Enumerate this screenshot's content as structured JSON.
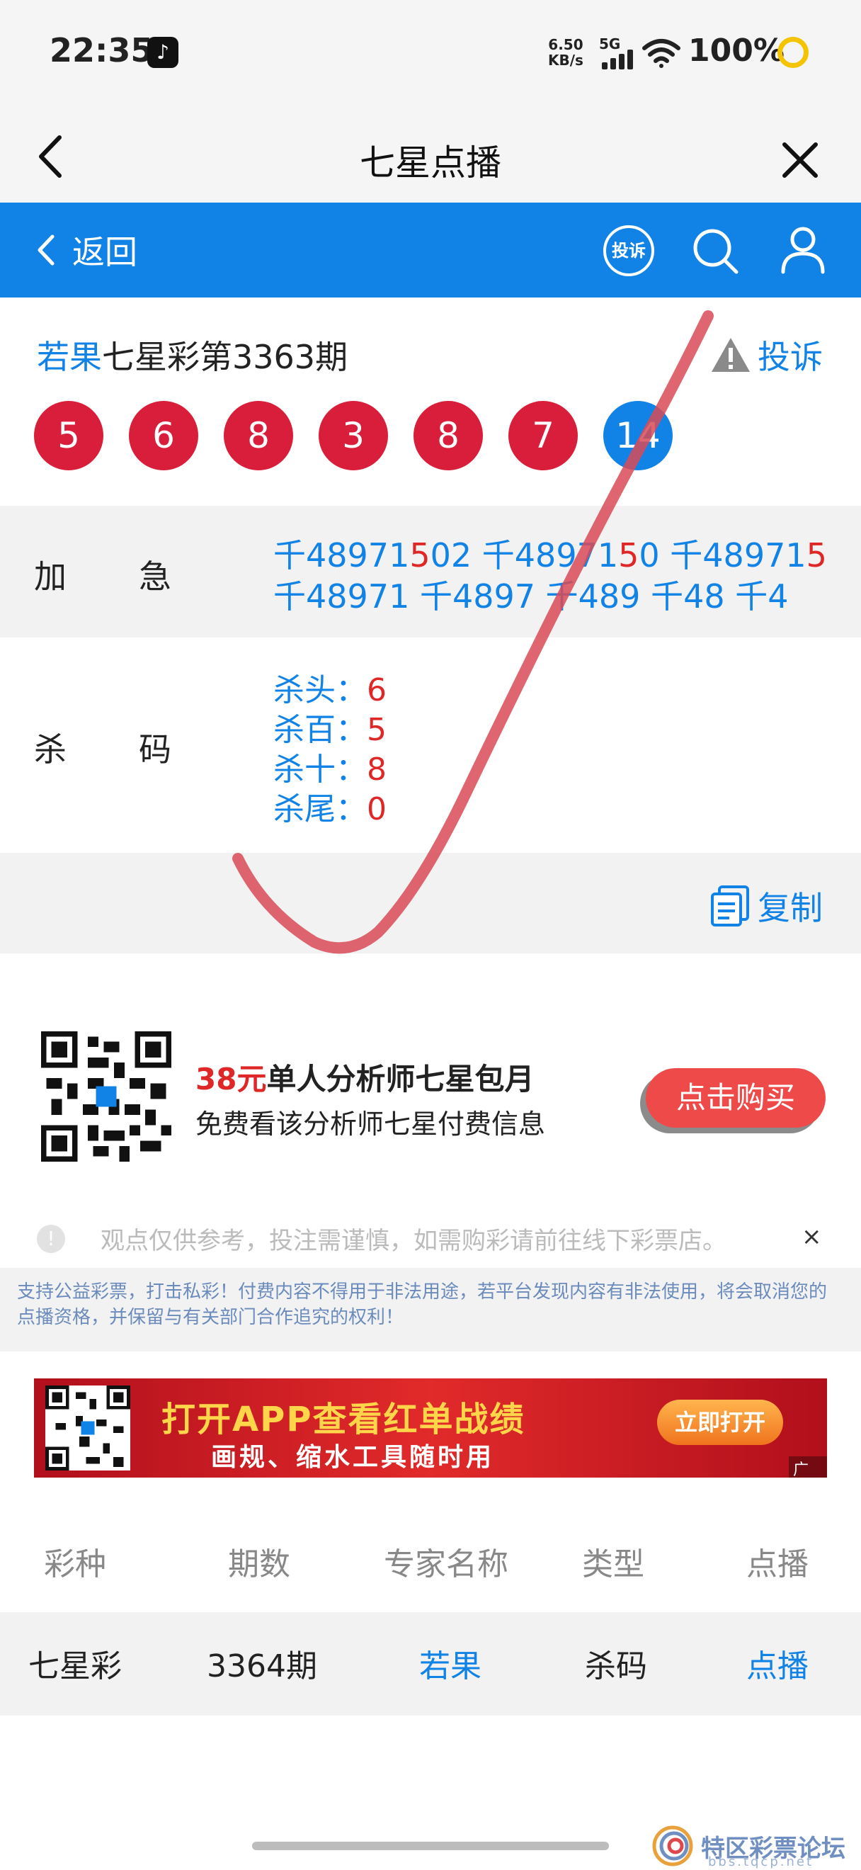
{
  "status_bar": {
    "time": "22:35",
    "net_speed_value": "6.50",
    "net_speed_unit": "KB/s",
    "network": "5G",
    "battery": "100%"
  },
  "title_bar": {
    "title": "七星点播"
  },
  "nav": {
    "back_label": "返回",
    "complain_label": "投诉"
  },
  "draw": {
    "expert": "若果",
    "issue_text": "七星彩第3363期",
    "report_label": "投诉",
    "numbers": [
      "5",
      "6",
      "8",
      "3",
      "8",
      "7",
      "14"
    ]
  },
  "combo": {
    "label_a": "加",
    "label_b": "急",
    "line1": [
      {
        "t": "千48971",
        "c": "b"
      },
      {
        "t": "5",
        "c": "r"
      },
      {
        "t": "02 千48971",
        "c": "b"
      },
      {
        "t": "5",
        "c": "r"
      },
      {
        "t": "0 千48971",
        "c": "b"
      },
      {
        "t": "5",
        "c": "r"
      }
    ],
    "line2": "千48971 千4897 千489 千48 千4"
  },
  "kill": {
    "label_a": "杀",
    "label_b": "码",
    "items": [
      {
        "label": "杀头：",
        "value": "6"
      },
      {
        "label": "杀百：",
        "value": "5"
      },
      {
        "label": "杀十：",
        "value": "8"
      },
      {
        "label": "杀尾：",
        "value": "0"
      }
    ]
  },
  "copy_label": "复制",
  "promo": {
    "price": "38元",
    "title_rest": "单人分析师七星包月",
    "subtitle": "免费看该分析师七星付费信息",
    "buy_label": "点击购买"
  },
  "notice": {
    "text": "观点仅供参考，投注需谨慎，如需购彩请前往线下彩票店。",
    "close": "×"
  },
  "disclaimer": "支持公益彩票，打击私彩！付费内容不得用于非法用途，若平台发现内容有非法使用，将会取消您的点播资格，并保留与有关部门合作追究的权利！",
  "banner": {
    "title": "打开APP查看红单战绩",
    "subtitle": "画规、缩水工具随时用",
    "open_label": "立即打开",
    "ad_tag": "广告"
  },
  "table": {
    "headers": [
      "彩种",
      "期数",
      "专家名称",
      "类型",
      "点播"
    ],
    "row": [
      "七星彩",
      "3364期",
      "若果",
      "杀码",
      "点播"
    ]
  },
  "watermark": {
    "text": "特区彩票论坛",
    "sub": "bbs.tqcp.net"
  },
  "colors": {
    "brand_blue": "#1283e6",
    "ball_red": "#d81e3a",
    "accent_red": "#e02727"
  }
}
